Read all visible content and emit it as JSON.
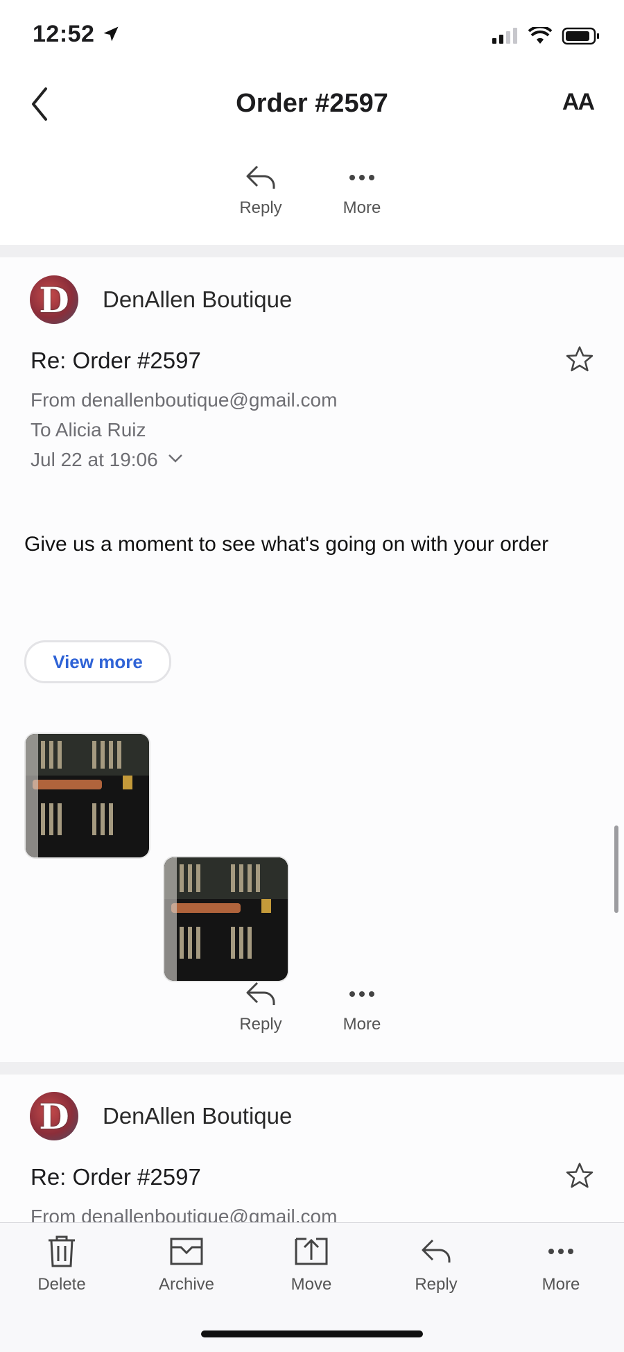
{
  "status": {
    "time": "12:52"
  },
  "header": {
    "title": "Order #2597",
    "text_size_label": "AA"
  },
  "top_actions": {
    "reply": "Reply",
    "more": "More"
  },
  "message1": {
    "sender": "DenAllen Boutique",
    "avatar_letter": "D",
    "subject": "Re: Order #2597",
    "from": "From denallenboutique@gmail.com",
    "to": "To Alicia Ruiz",
    "date": "Jul 22 at 19:06",
    "body": "Give us a moment to see what's going on with your order",
    "view_more": "View more",
    "actions": {
      "reply": "Reply",
      "more": "More"
    }
  },
  "message2": {
    "sender": "DenAllen Boutique",
    "avatar_letter": "D",
    "subject": "Re: Order #2597",
    "from": "From denallenboutique@gmail.com"
  },
  "toolbar": {
    "delete": "Delete",
    "archive": "Archive",
    "move": "Move",
    "reply": "Reply",
    "more": "More"
  },
  "colors": {
    "accent": "#2f63d6",
    "divider": "#efeff1",
    "muted": "#6e6e73"
  }
}
